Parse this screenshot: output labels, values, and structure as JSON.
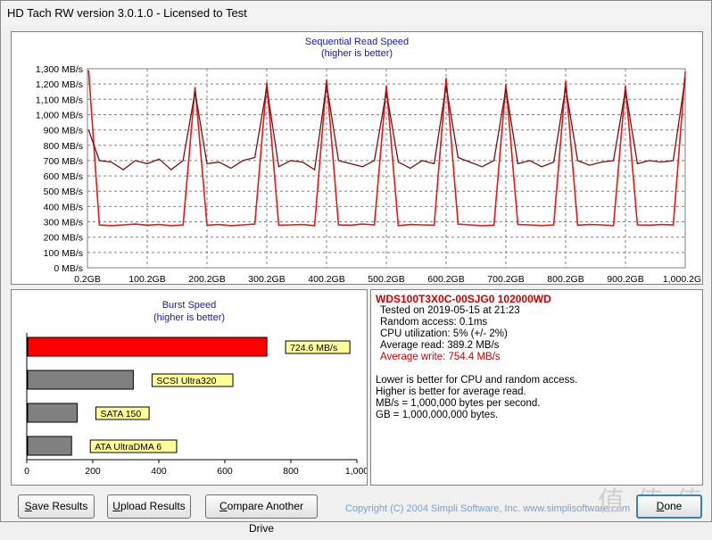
{
  "window": {
    "title": "HD Tach RW version 3.0.1.0 - Licensed to Test"
  },
  "colors": {
    "read_line": "#e8171a",
    "write_line": "#7a0f0f",
    "burst_bar": "#ff0000",
    "compare_bar": "#808080",
    "label_bg": "#ffff99",
    "title_blue": "#1a1a9c"
  },
  "chart_data": [
    {
      "type": "line",
      "title": "Sequential Read Speed",
      "subtitle": "(higher is better)",
      "xlabel": "",
      "ylabel": "",
      "x_ticks": [
        "0.2GB",
        "100.2GB",
        "200.2GB",
        "300.2GB",
        "400.2GB",
        "500.2GB",
        "600.2GB",
        "700.2GB",
        "800.2GB",
        "900.2GB",
        "1,000.2GB"
      ],
      "y_ticks": [
        "0 MB/s",
        "100 MB/s",
        "200 MB/s",
        "300 MB/s",
        "400 MB/s",
        "500 MB/s",
        "600 MB/s",
        "700 MB/s",
        "800 MB/s",
        "900 MB/s",
        "1,000 MB/s",
        "1,100 MB/s",
        "1,200 MB/s",
        "1,300 MB/s"
      ],
      "ylim": [
        0,
        1300
      ],
      "xlim": [
        0.2,
        1000.2
      ],
      "grid": true,
      "series": [
        {
          "role": "read",
          "x": [
            0.2,
            2,
            4,
            6,
            8,
            10,
            12,
            14,
            16,
            18,
            20,
            22,
            24,
            26,
            28,
            30,
            32,
            34,
            36,
            38,
            40,
            42,
            44,
            46,
            48,
            50,
            52,
            54,
            56,
            58,
            60,
            62,
            64,
            66,
            68,
            70,
            72,
            74,
            76,
            78,
            80,
            82,
            84,
            86,
            88,
            90,
            92,
            94,
            96,
            98,
            100
          ],
          "values": [
            1290,
            280,
            275,
            280,
            285,
            278,
            282,
            275,
            280,
            1180,
            278,
            282,
            275,
            280,
            285,
            1210,
            278,
            280,
            282,
            275,
            1230,
            280,
            278,
            285,
            280,
            1190,
            275,
            282,
            280,
            278,
            1240,
            285,
            280,
            275,
            278,
            1200,
            282,
            280,
            276,
            280,
            1220,
            278,
            282,
            280,
            275,
            1190,
            280,
            278,
            282,
            280,
            1280
          ]
        },
        {
          "role": "write",
          "x": [
            0.2,
            2,
            4,
            6,
            8,
            10,
            12,
            14,
            16,
            18,
            20,
            22,
            24,
            26,
            28,
            30,
            32,
            34,
            36,
            38,
            40,
            42,
            44,
            46,
            48,
            50,
            52,
            54,
            56,
            58,
            60,
            62,
            64,
            66,
            68,
            70,
            72,
            74,
            76,
            78,
            80,
            82,
            84,
            86,
            88,
            90,
            92,
            94,
            96,
            98,
            100
          ],
          "values": [
            900,
            700,
            690,
            640,
            700,
            680,
            710,
            640,
            700,
            1150,
            680,
            690,
            650,
            700,
            720,
            1180,
            660,
            700,
            690,
            640,
            1200,
            700,
            680,
            660,
            700,
            1150,
            690,
            650,
            700,
            680,
            1190,
            720,
            690,
            660,
            700,
            1170,
            680,
            700,
            660,
            690,
            1180,
            700,
            670,
            690,
            700,
            1160,
            680,
            700,
            690,
            700,
            1240
          ]
        }
      ]
    },
    {
      "type": "bar",
      "orientation": "horizontal",
      "title": "Burst Speed",
      "subtitle": "(higher is better)",
      "x_ticks": [
        "0",
        "200",
        "400",
        "600",
        "800",
        "1,000"
      ],
      "xlim": [
        0,
        1000
      ],
      "categories": [
        "724.6 MB/s",
        "SCSI Ultra320",
        "SATA 150",
        "ATA UltraDMA 6"
      ],
      "values": [
        724.6,
        320,
        150,
        133
      ],
      "highlight": [
        true,
        false,
        false,
        false
      ]
    }
  ],
  "info": {
    "drive_name": "WDS100T3X0C-00SJG0 102000WD",
    "lines": [
      "Tested on 2019-05-15 at 21:23",
      "Random access: 0.1ms",
      "CPU utilization: 5% (+/- 2%)",
      "Average read: 389.2 MB/s",
      "Average write: 754.4 MB/s"
    ],
    "notes": [
      "Lower is better for CPU and random access.",
      "Higher is better for average read.",
      "MB/s = 1,000,000 bytes per second.",
      "GB = 1,000,000,000 bytes."
    ]
  },
  "buttons": {
    "save": {
      "ul": "S",
      "rest": "ave Results"
    },
    "upload": {
      "ul": "U",
      "rest": "pload Results"
    },
    "compare": {
      "ul": "C",
      "rest": "ompare Another Drive"
    },
    "done": {
      "ul": "D",
      "rest": "one"
    }
  },
  "footer": {
    "copyright": "Copyright (C) 2004 Simpli Software, Inc. www.simplisoftware.com",
    "watermark": "值 值 值"
  }
}
